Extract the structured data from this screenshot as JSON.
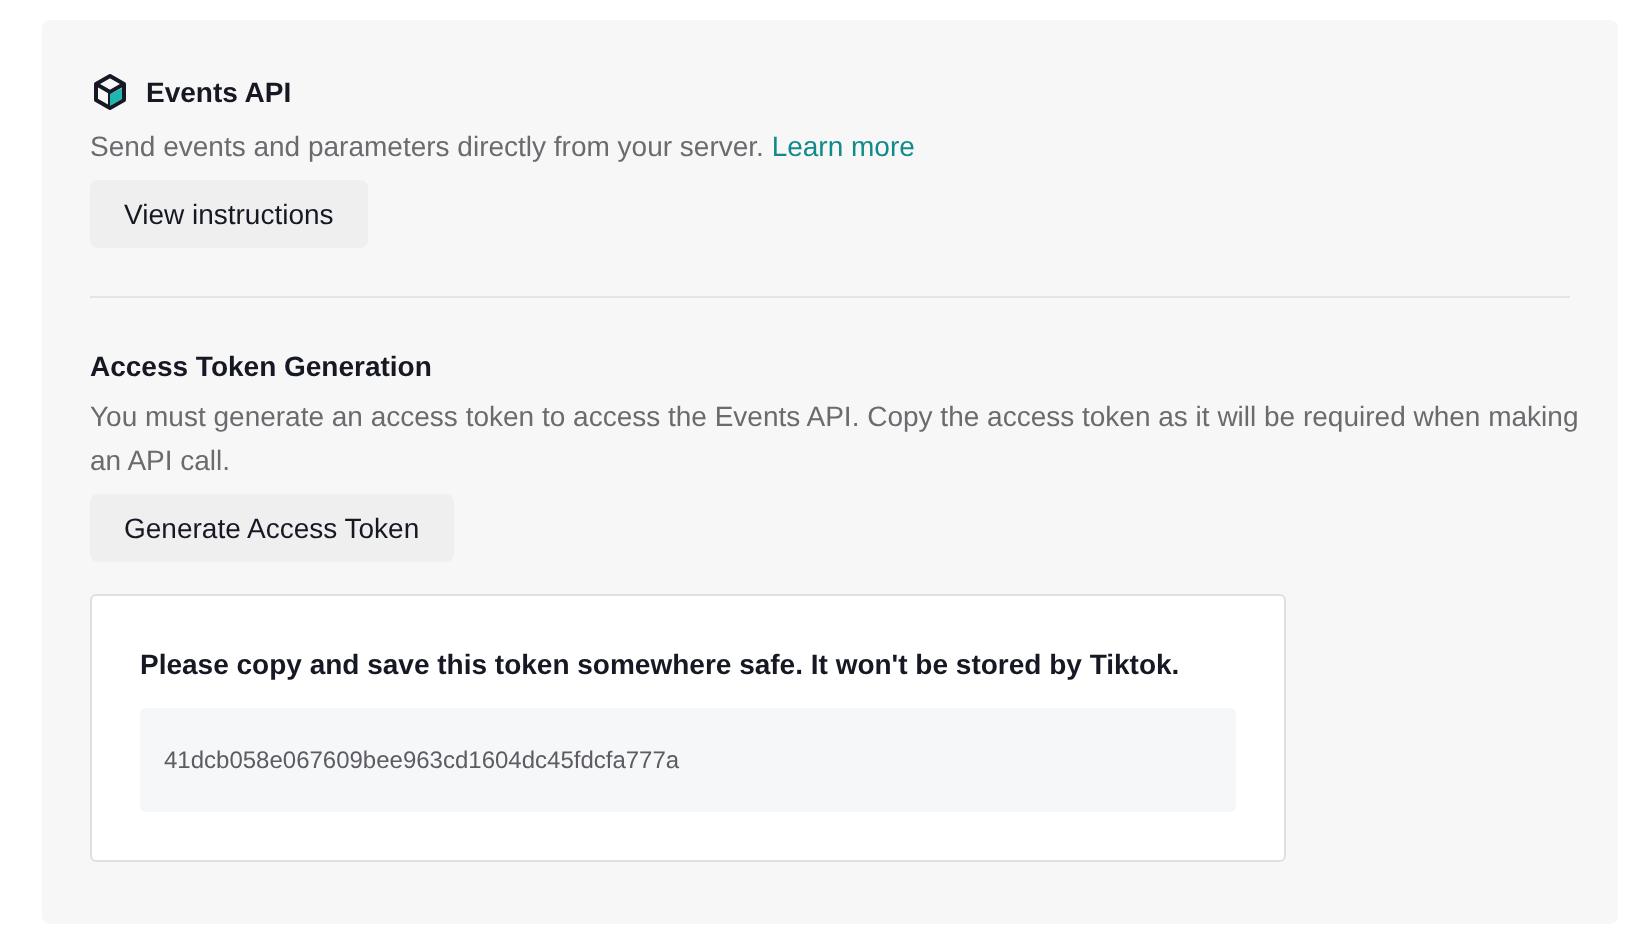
{
  "events_api": {
    "title": "Events API",
    "description": "Send events and parameters directly from your server.",
    "link": "Learn more",
    "button": "View instructions"
  },
  "access_token": {
    "title": "Access Token Generation",
    "description": "You must generate an access token to access the Events API. Copy the access token as it will be required when making an API call.",
    "button": "Generate Access Token",
    "token_card": {
      "message": "Please copy and save this token somewhere safe. It won't be stored by Tiktok.",
      "token": "41dcb058e067609bee963cd1604dc45fdcfa777a"
    }
  }
}
